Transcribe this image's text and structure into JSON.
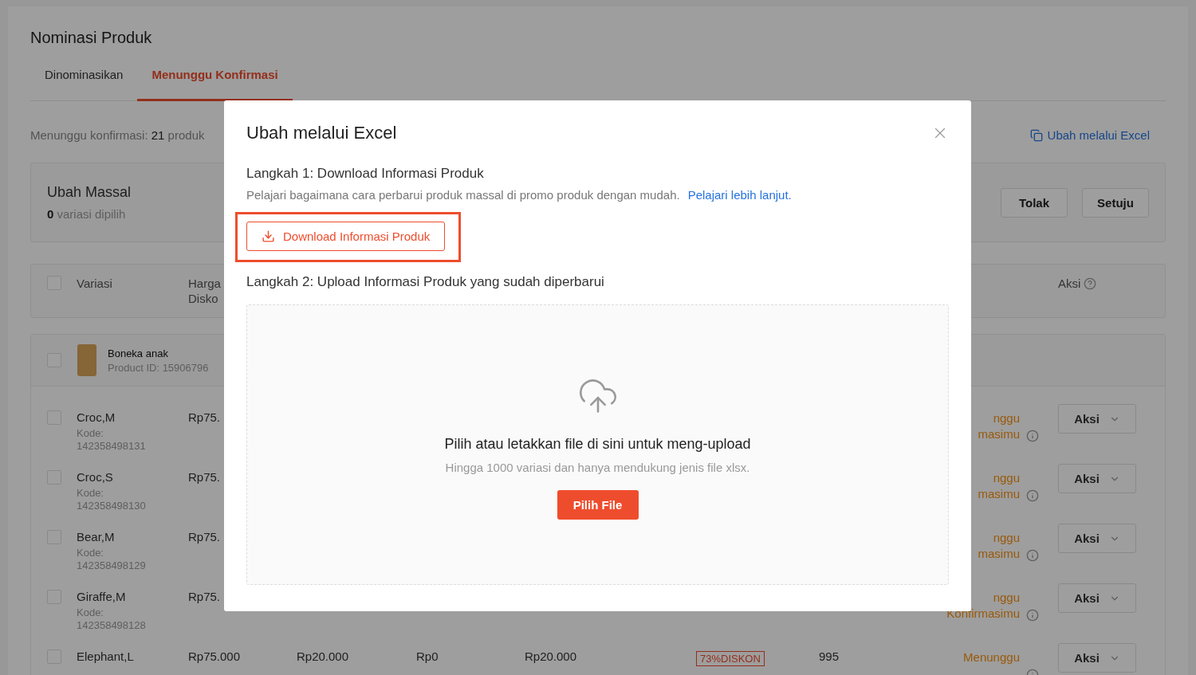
{
  "page": {
    "title": "Nominasi Produk",
    "tabs": [
      {
        "label": "Dinominasikan",
        "selected": false
      },
      {
        "label": "Menunggu Konfirmasi",
        "selected": true
      }
    ],
    "summary": "Menunggu konfirmasi: **21** produk",
    "excel_link": "Ubah melalui Excel",
    "bulk": {
      "title": "Ubah Massal",
      "count": "**0** variasi dipilih",
      "buttons": [
        "Tolak",
        "Setuju"
      ]
    },
    "table": {
      "select_all": {
        "checked": false
      },
      "headers": {
        "variant": "Variasi",
        "price": "Harga\nDisko",
        "action": "Aksi"
      },
      "product": {
        "name": "Boneka anak",
        "id": "Product ID: 15906796",
        "checked": false
      },
      "rows": [
        {
          "checked": false,
          "variant": "Croc,M",
          "code": "Kode:\n142358498131",
          "cells": [
            "Rp75."
          ],
          "status": "nggu\nmasimu",
          "action": "Aksi"
        },
        {
          "checked": false,
          "variant": "Croc,S",
          "code": "Kode:\n142358498130",
          "cells": [
            "Rp75."
          ],
          "status": "nggu\nmasimu",
          "action": "Aksi"
        },
        {
          "checked": false,
          "variant": "Bear,M",
          "code": "Kode:\n142358498129",
          "cells": [
            "Rp75."
          ],
          "status": "nggu\nmasimu",
          "action": "Aksi"
        },
        {
          "checked": false,
          "variant": "Giraffe,M",
          "code": "Kode:\n142358498128",
          "cells": [
            "Rp75."
          ],
          "status": "nggu\nKonfirmasimu",
          "action": "Aksi"
        },
        {
          "checked": false,
          "variant": "Elephant,L",
          "cells": [
            "Rp75.000",
            "Rp20.000",
            "Rp0",
            "Rp20.000"
          ],
          "badge": "73%DISKON",
          "stock": "995",
          "status": "Menunggu",
          "action": "Aksi"
        }
      ]
    }
  },
  "dialog": {
    "title": "Ubah melalui Excel",
    "step1": {
      "label": "Langkah 1: Download Informasi Produk",
      "text": "Pelajari bagaimana cara perbarui produk massal di promo produk dengan mudah.",
      "link": "Pelajari lebih lanjut.",
      "button": "Download Informasi Produk"
    },
    "step2": {
      "label": "Langkah 2: Upload Informasi Produk yang sudah diperbarui",
      "drop_title": "Pilih atau letakkan file di sini untuk meng-upload",
      "drop_hint": "Hingga 1000 variasi dan hanya mendukung jenis file xlsx.",
      "button": "Pilih File"
    }
  }
}
